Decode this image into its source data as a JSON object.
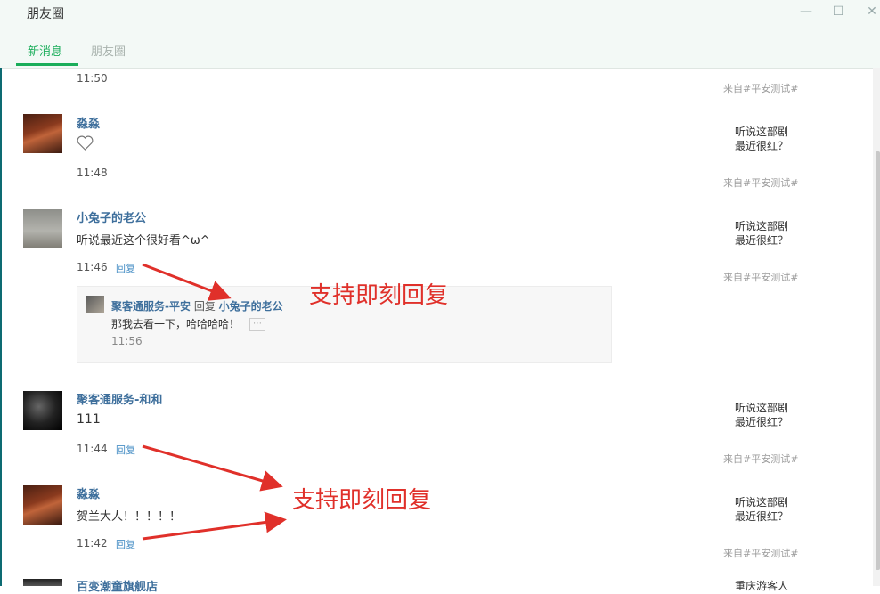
{
  "window": {
    "title": "朋友圈",
    "minimize": "—",
    "maximize": "☐",
    "close": "✕"
  },
  "tabs": [
    {
      "label": "新消息",
      "active": true
    },
    {
      "label": "朋友圈",
      "active": false
    }
  ],
  "posts": [
    {
      "time": "11:50",
      "source": "来自#平安测试#"
    },
    {
      "name": "淼淼",
      "icon": "heart-icon",
      "time": "11:48",
      "snippet": [
        "听说这部剧",
        "最近很红？"
      ],
      "source": "来自#平安测试#"
    },
    {
      "name": "小兔子的老公",
      "text": "听说最近这个很好看^ω^",
      "time": "11:46",
      "reply": "回复",
      "snippet": [
        "听说这部剧",
        "最近很红？"
      ],
      "source": "来自#平安测试#",
      "comment": {
        "author": "聚客通服务-平安",
        "reply_word": "回复",
        "target": "小兔子的老公",
        "text": "那我去看一下，哈哈哈哈！",
        "time": "11:56",
        "more_icon": "⋯"
      }
    },
    {
      "name": "聚客通服务-和和",
      "text": "111",
      "time": "11:44",
      "reply": "回复",
      "snippet": [
        "听说这部剧",
        "最近很红？"
      ],
      "source": "来自#平安测试#"
    },
    {
      "name": "淼淼",
      "text": "贺兰大人！！！！！",
      "time": "11:42",
      "reply": "回复",
      "snippet": [
        "听说这部剧",
        "最近很红？"
      ],
      "source": "来自#平安测试#"
    },
    {
      "name": "百变潮童旗舰店",
      "snippet": [
        "重庆游客人"
      ]
    }
  ],
  "annotations": [
    "支持即刻回复",
    "支持即刻回复"
  ],
  "colors": {
    "accent": "#1aad5a",
    "name": "#3e6f9c",
    "annotation": "#e0302a"
  }
}
